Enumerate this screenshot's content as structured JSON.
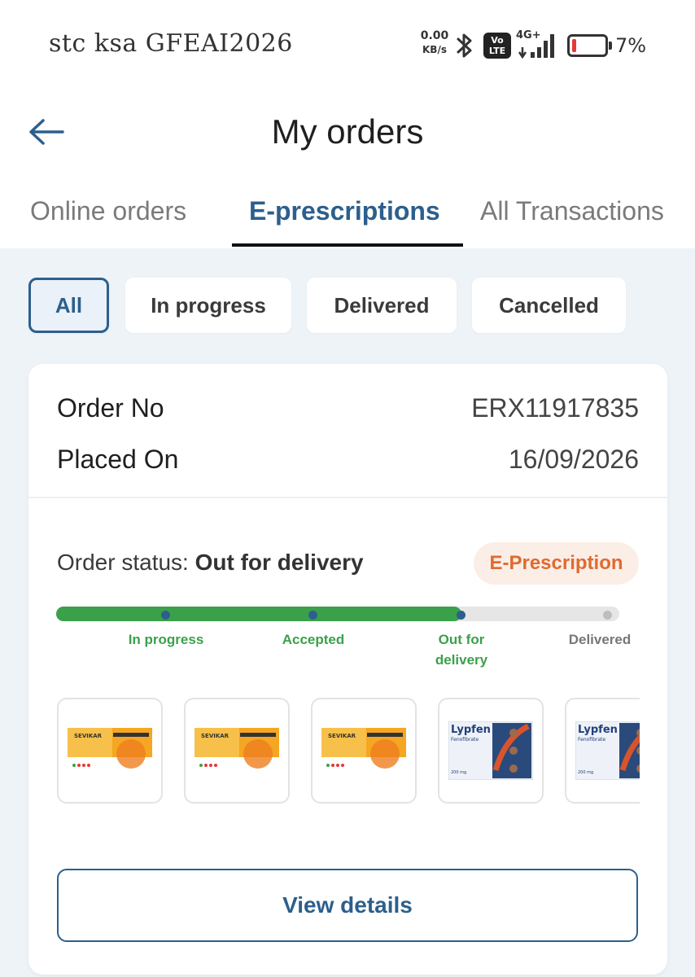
{
  "status_bar": {
    "carrier": "stc ksa GFEAI2026",
    "net_speed_value": "0.00",
    "net_speed_unit": "KB/s",
    "volte_top": "Vo",
    "volte_bottom": "LTE",
    "network_type": "4G+",
    "battery_percent": "7%",
    "battery_level": 0.07
  },
  "header": {
    "title": "My orders"
  },
  "tabs": [
    {
      "label": "Online orders",
      "active": false
    },
    {
      "label": "E-prescriptions",
      "active": true
    },
    {
      "label": "All Transactions",
      "active": false
    }
  ],
  "filters": [
    {
      "label": "All",
      "active": true
    },
    {
      "label": "In progress",
      "active": false
    },
    {
      "label": "Delivered",
      "active": false
    },
    {
      "label": "Cancelled",
      "active": false
    }
  ],
  "order": {
    "order_no_label": "Order No",
    "order_no_value": "ERX11917835",
    "placed_on_label": "Placed On",
    "placed_on_value": "16/09/2026",
    "status_prefix": "Order status: ",
    "status_value": "Out for delivery",
    "badge": "E-Prescription",
    "progress_fraction": 0.72,
    "steps": [
      {
        "label": "In progress",
        "done": true
      },
      {
        "label": "Accepted",
        "done": true
      },
      {
        "label": "Out for delivery",
        "done": true
      },
      {
        "label": "Delivered",
        "done": false
      }
    ],
    "products": [
      {
        "brand": "SEVIKAR HCT",
        "type": "sevikar"
      },
      {
        "brand": "SEVIKAR HCT",
        "type": "sevikar"
      },
      {
        "brand": "SEVIKAR HCT",
        "type": "sevikar"
      },
      {
        "brand": "Lypfen",
        "generic": "Fenofibrate",
        "type": "lypfen"
      },
      {
        "brand": "Lypfen",
        "generic": "Fenofibrate",
        "type": "lypfen"
      }
    ],
    "view_details_label": "View details"
  },
  "colors": {
    "primary": "#2c5f8d",
    "progress_green": "#3aa14a",
    "badge_orange": "#e06a2f",
    "badge_bg": "#fbeee7",
    "content_bg": "#eef3f8"
  }
}
